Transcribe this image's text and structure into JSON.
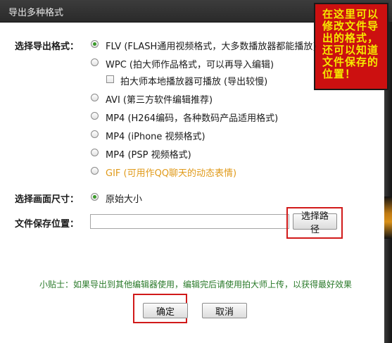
{
  "window": {
    "title": "导出多种格式"
  },
  "note": {
    "text": "在这里可以修改文件导出的格式，还可以知道文件保存的位置！"
  },
  "format": {
    "label": "选择导出格式：",
    "options": [
      {
        "label": "FLV (FLASH通用视频格式，大多数播放器都能播放)",
        "checked": true
      },
      {
        "label": "WPC (拍大师作品格式，可以再导入编辑)",
        "checked": false
      },
      {
        "label": "AVI (第三方软件编辑推荐)",
        "checked": false
      },
      {
        "label": "MP4 (H264编码，各种数码产品适用格式)",
        "checked": false
      },
      {
        "label": "MP4 (iPhone 视频格式)",
        "checked": false
      },
      {
        "label": "MP4 (PSP 视频格式)",
        "checked": false
      },
      {
        "label": "GIF (可用作QQ聊天的动态表情)",
        "checked": false
      }
    ],
    "wpc_checkbox": {
      "label": "拍大师本地播放器可播放",
      "hint": "(导出较慢)",
      "checked": false
    }
  },
  "size": {
    "label": "选择画面尺寸：",
    "option": "原始大小",
    "checked": true
  },
  "save": {
    "label": "文件保存位置：",
    "path_value": "",
    "browse_button": "选择路径"
  },
  "tip": {
    "text": "小贴士：如果导出到其他编辑器使用，编辑完后请使用拍大师上传，以获得最好效果"
  },
  "buttons": {
    "ok": "确定",
    "cancel": "取消"
  },
  "colors": {
    "selected_radio": "#3a9a2a",
    "gif_option": "#e09a1a",
    "tip_text": "#2a7a2a",
    "highlight_border": "#d11a1a",
    "note_bg": "#cc1010",
    "note_text": "#f5e800"
  }
}
